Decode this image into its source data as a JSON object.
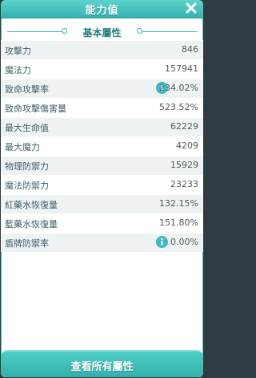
{
  "window": {
    "title": "能力值",
    "close_icon": "close-icon",
    "section_title": "基本屬性",
    "accent_color": "#39b7b5"
  },
  "stats": [
    {
      "label": "攻擊力",
      "value": "846"
    },
    {
      "label": "魔法力",
      "value": "157941"
    },
    {
      "label": "致命攻擊率",
      "value": "234.02%",
      "info": true
    },
    {
      "label": "致命攻擊傷害量",
      "value": "523.52%"
    },
    {
      "label": "最大生命值",
      "value": "62229"
    },
    {
      "label": "最大魔力",
      "value": "4209"
    },
    {
      "label": "物理防禦力",
      "value": "15929"
    },
    {
      "label": "魔法防禦力",
      "value": "23233"
    },
    {
      "label": "紅藥水恢復量",
      "value": "132.15%"
    },
    {
      "label": "藍藥水恢復量",
      "value": "151.80%"
    },
    {
      "label": "盾牌防禦率",
      "value": "0.00%",
      "info": true
    }
  ],
  "footer": {
    "button_label": "查看所有屬性"
  }
}
